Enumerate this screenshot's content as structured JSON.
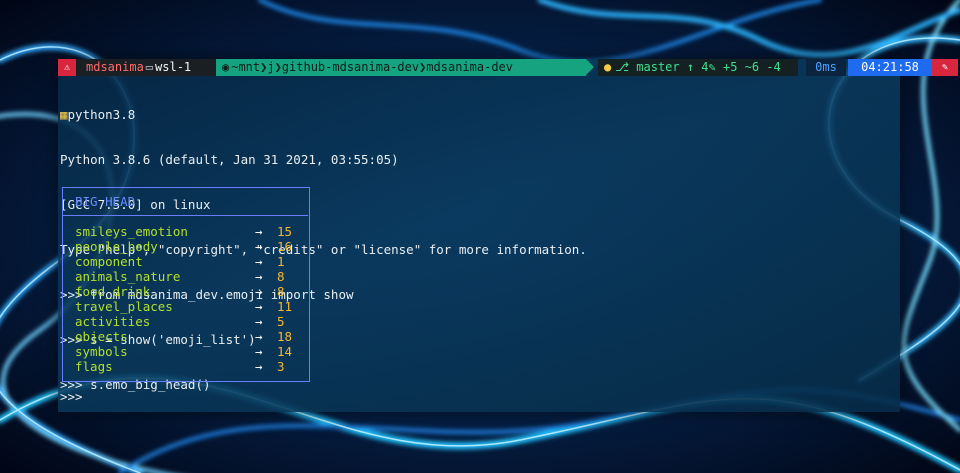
{
  "prompt": {
    "user": "mdsanima",
    "host": "wsl-1",
    "path": "~mnt❯j❯github-mdsanima-dev❯mdsanima-dev",
    "git": "⎇ master ↑ 4✎ +5 ~6 -4",
    "duration": "0ms",
    "clock": "04:21:58"
  },
  "terminal_lines": [
    "python3.8",
    "Python 3.8.6 (default, Jan 31 2021, 03:55:05)",
    "[GCC 7.5.0] on linux",
    "Type \"help\", \"copyright\", \"credits\" or \"license\" for more information.",
    ">>> from mdsanima_dev.emoji import show",
    ">>> s = show('emoji_list')",
    ">>> s.emo_big_head()"
  ],
  "panel": {
    "title": "BIG HEAD",
    "rows": [
      {
        "name": "smileys_emotion",
        "arrow": "→",
        "value": "15"
      },
      {
        "name": "people_body",
        "arrow": "→",
        "value": "16"
      },
      {
        "name": "component",
        "arrow": "→",
        "value": "1"
      },
      {
        "name": "animals_nature",
        "arrow": "→",
        "value": "8"
      },
      {
        "name": "food_drink",
        "arrow": "→",
        "value": "8"
      },
      {
        "name": "travel_places",
        "arrow": "→",
        "value": "11"
      },
      {
        "name": "activities",
        "arrow": "→",
        "value": "5"
      },
      {
        "name": "objects",
        "arrow": "→",
        "value": "18"
      },
      {
        "name": "symbols",
        "arrow": "→",
        "value": "14"
      },
      {
        "name": "flags",
        "arrow": "→",
        "value": "3"
      }
    ]
  },
  "final_prompt": ">>>",
  "colors": {
    "panel_border": "#6b7dff",
    "key_color": "#b3e02b",
    "value_color": "#f7b731",
    "path_segment": "#16a37f",
    "clock_segment": "#1e6bf0",
    "user_icon_bg": "#d7263d"
  },
  "icons": {
    "user": "warning-icon",
    "host": "laptop-icon",
    "path_start": "linux-icon",
    "git": "github-icon",
    "line0": "snake-icon",
    "end": "lock-icon"
  }
}
